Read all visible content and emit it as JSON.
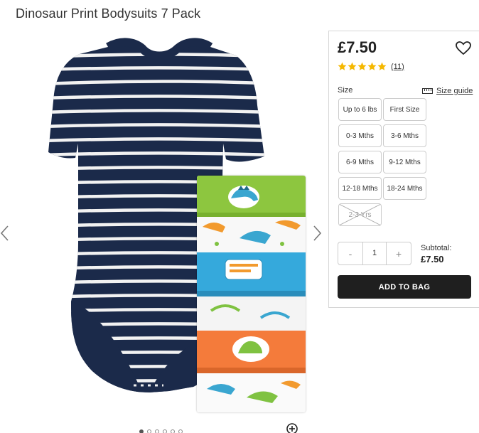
{
  "product": {
    "title": "Dinosaur Print Bodysuits 7 Pack",
    "price": "£7.50",
    "rating": 5,
    "review_count": "(11)"
  },
  "gallery": {
    "slide_count": 6,
    "active_slide": 0
  },
  "size": {
    "label": "Size",
    "guide_label": "Size guide",
    "options": [
      {
        "label": "Up to 6 lbs",
        "available": true
      },
      {
        "label": "First Size",
        "available": true
      },
      {
        "label": "0-3 Mths",
        "available": true
      },
      {
        "label": "3-6 Mths",
        "available": true
      },
      {
        "label": "6-9 Mths",
        "available": true
      },
      {
        "label": "9-12 Mths",
        "available": true
      },
      {
        "label": "12-18 Mths",
        "available": true
      },
      {
        "label": "18-24 Mths",
        "available": true
      },
      {
        "label": "2-3 Yrs",
        "available": false
      }
    ]
  },
  "quantity": {
    "minus": "-",
    "value": "1",
    "plus": "+"
  },
  "subtotal": {
    "label": "Subtotal:",
    "value": "£7.50"
  },
  "actions": {
    "add_to_bag": "ADD TO BAG"
  },
  "icons": {
    "prev": "chevron-left-icon",
    "next": "chevron-right-icon",
    "wishlist": "heart-icon",
    "star": "star-icon",
    "ruler": "ruler-icon",
    "zoom": "zoom-plus-icon"
  },
  "colors": {
    "star": "#f5b800",
    "button": "#1f1f1f",
    "navy": "#1b2a4a"
  }
}
